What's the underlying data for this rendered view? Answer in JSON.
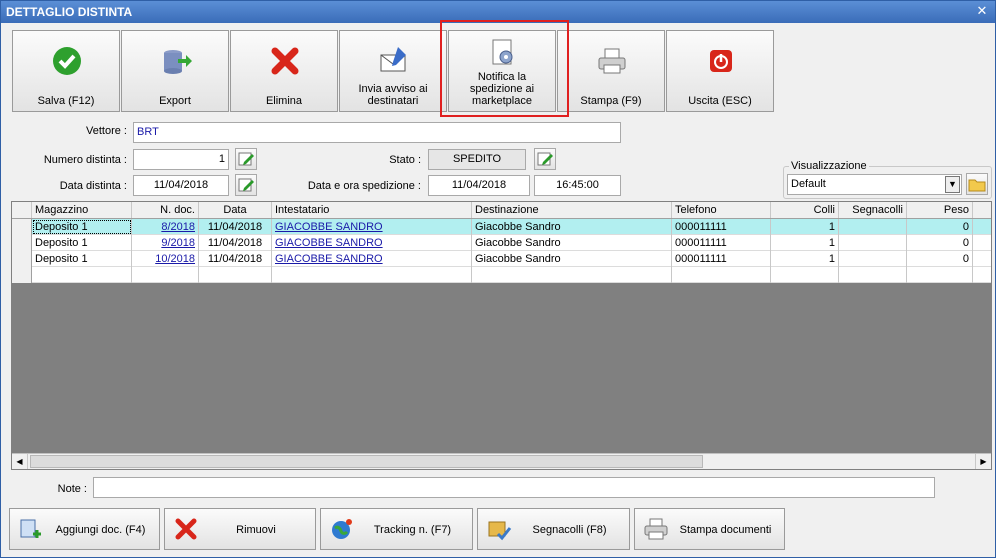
{
  "window": {
    "title": "DETTAGLIO DISTINTA"
  },
  "toolbar": {
    "save": "Salva (F12)",
    "export": "Export",
    "delete": "Elimina",
    "notify": "Invia avviso ai destinatari",
    "marketplace": "Notifica la spedizione ai marketplace",
    "print": "Stampa (F9)",
    "exit": "Uscita (ESC)"
  },
  "form": {
    "carrier_label": "Vettore :",
    "carrier": "BRT",
    "number_label": "Numero distinta :",
    "number": "1",
    "date_label": "Data distinta :",
    "date": "11/04/2018",
    "status_label": "Stato :",
    "status": "SPEDITO",
    "ship_label": "Data e ora spedizione :",
    "ship_date": "11/04/2018",
    "ship_time": "16:45:00",
    "view_label": "Visualizzazione",
    "view": "Default",
    "notes_label": "Note :"
  },
  "table": {
    "headers": [
      "Magazzino",
      "N. doc.",
      "Data",
      "Intestatario",
      "Destinazione",
      "Telefono",
      "Colli",
      "Segnacolli",
      "Peso"
    ],
    "rows": [
      [
        "Deposito 1",
        "8/2018",
        "11/04/2018",
        "GIACOBBE SANDRO",
        "Giacobbe Sandro",
        "000011111",
        "1",
        "",
        "0"
      ],
      [
        "Deposito 1",
        "9/2018",
        "11/04/2018",
        "GIACOBBE SANDRO",
        "Giacobbe Sandro",
        "000011111",
        "1",
        "",
        "0"
      ],
      [
        "Deposito 1",
        "10/2018",
        "11/04/2018",
        "GIACOBBE SANDRO",
        "Giacobbe Sandro",
        "000011111",
        "1",
        "",
        "0"
      ]
    ]
  },
  "bottom": {
    "add": "Aggiungi doc. (F4)",
    "remove": "Rimuovi",
    "tracking": "Tracking n. (F7)",
    "labels": "Segnacolli (F8)",
    "printdocs": "Stampa documenti"
  }
}
